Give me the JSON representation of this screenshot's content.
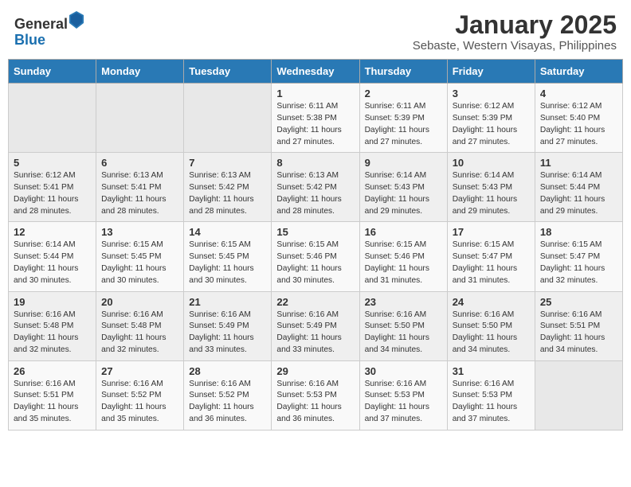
{
  "header": {
    "logo_general": "General",
    "logo_blue": "Blue",
    "main_title": "January 2025",
    "subtitle": "Sebaste, Western Visayas, Philippines"
  },
  "calendar": {
    "days_of_week": [
      "Sunday",
      "Monday",
      "Tuesday",
      "Wednesday",
      "Thursday",
      "Friday",
      "Saturday"
    ],
    "weeks": [
      [
        {
          "day": "",
          "sunrise": "",
          "sunset": "",
          "daylight": ""
        },
        {
          "day": "",
          "sunrise": "",
          "sunset": "",
          "daylight": ""
        },
        {
          "day": "",
          "sunrise": "",
          "sunset": "",
          "daylight": ""
        },
        {
          "day": "1",
          "sunrise": "6:11 AM",
          "sunset": "5:38 PM",
          "daylight": "11 hours and 27 minutes."
        },
        {
          "day": "2",
          "sunrise": "6:11 AM",
          "sunset": "5:39 PM",
          "daylight": "11 hours and 27 minutes."
        },
        {
          "day": "3",
          "sunrise": "6:12 AM",
          "sunset": "5:39 PM",
          "daylight": "11 hours and 27 minutes."
        },
        {
          "day": "4",
          "sunrise": "6:12 AM",
          "sunset": "5:40 PM",
          "daylight": "11 hours and 27 minutes."
        }
      ],
      [
        {
          "day": "5",
          "sunrise": "6:12 AM",
          "sunset": "5:41 PM",
          "daylight": "11 hours and 28 minutes."
        },
        {
          "day": "6",
          "sunrise": "6:13 AM",
          "sunset": "5:41 PM",
          "daylight": "11 hours and 28 minutes."
        },
        {
          "day": "7",
          "sunrise": "6:13 AM",
          "sunset": "5:42 PM",
          "daylight": "11 hours and 28 minutes."
        },
        {
          "day": "8",
          "sunrise": "6:13 AM",
          "sunset": "5:42 PM",
          "daylight": "11 hours and 28 minutes."
        },
        {
          "day": "9",
          "sunrise": "6:14 AM",
          "sunset": "5:43 PM",
          "daylight": "11 hours and 29 minutes."
        },
        {
          "day": "10",
          "sunrise": "6:14 AM",
          "sunset": "5:43 PM",
          "daylight": "11 hours and 29 minutes."
        },
        {
          "day": "11",
          "sunrise": "6:14 AM",
          "sunset": "5:44 PM",
          "daylight": "11 hours and 29 minutes."
        }
      ],
      [
        {
          "day": "12",
          "sunrise": "6:14 AM",
          "sunset": "5:44 PM",
          "daylight": "11 hours and 30 minutes."
        },
        {
          "day": "13",
          "sunrise": "6:15 AM",
          "sunset": "5:45 PM",
          "daylight": "11 hours and 30 minutes."
        },
        {
          "day": "14",
          "sunrise": "6:15 AM",
          "sunset": "5:45 PM",
          "daylight": "11 hours and 30 minutes."
        },
        {
          "day": "15",
          "sunrise": "6:15 AM",
          "sunset": "5:46 PM",
          "daylight": "11 hours and 30 minutes."
        },
        {
          "day": "16",
          "sunrise": "6:15 AM",
          "sunset": "5:46 PM",
          "daylight": "11 hours and 31 minutes."
        },
        {
          "day": "17",
          "sunrise": "6:15 AM",
          "sunset": "5:47 PM",
          "daylight": "11 hours and 31 minutes."
        },
        {
          "day": "18",
          "sunrise": "6:15 AM",
          "sunset": "5:47 PM",
          "daylight": "11 hours and 32 minutes."
        }
      ],
      [
        {
          "day": "19",
          "sunrise": "6:16 AM",
          "sunset": "5:48 PM",
          "daylight": "11 hours and 32 minutes."
        },
        {
          "day": "20",
          "sunrise": "6:16 AM",
          "sunset": "5:48 PM",
          "daylight": "11 hours and 32 minutes."
        },
        {
          "day": "21",
          "sunrise": "6:16 AM",
          "sunset": "5:49 PM",
          "daylight": "11 hours and 33 minutes."
        },
        {
          "day": "22",
          "sunrise": "6:16 AM",
          "sunset": "5:49 PM",
          "daylight": "11 hours and 33 minutes."
        },
        {
          "day": "23",
          "sunrise": "6:16 AM",
          "sunset": "5:50 PM",
          "daylight": "11 hours and 34 minutes."
        },
        {
          "day": "24",
          "sunrise": "6:16 AM",
          "sunset": "5:50 PM",
          "daylight": "11 hours and 34 minutes."
        },
        {
          "day": "25",
          "sunrise": "6:16 AM",
          "sunset": "5:51 PM",
          "daylight": "11 hours and 34 minutes."
        }
      ],
      [
        {
          "day": "26",
          "sunrise": "6:16 AM",
          "sunset": "5:51 PM",
          "daylight": "11 hours and 35 minutes."
        },
        {
          "day": "27",
          "sunrise": "6:16 AM",
          "sunset": "5:52 PM",
          "daylight": "11 hours and 35 minutes."
        },
        {
          "day": "28",
          "sunrise": "6:16 AM",
          "sunset": "5:52 PM",
          "daylight": "11 hours and 36 minutes."
        },
        {
          "day": "29",
          "sunrise": "6:16 AM",
          "sunset": "5:53 PM",
          "daylight": "11 hours and 36 minutes."
        },
        {
          "day": "30",
          "sunrise": "6:16 AM",
          "sunset": "5:53 PM",
          "daylight": "11 hours and 37 minutes."
        },
        {
          "day": "31",
          "sunrise": "6:16 AM",
          "sunset": "5:53 PM",
          "daylight": "11 hours and 37 minutes."
        },
        {
          "day": "",
          "sunrise": "",
          "sunset": "",
          "daylight": ""
        }
      ]
    ]
  }
}
